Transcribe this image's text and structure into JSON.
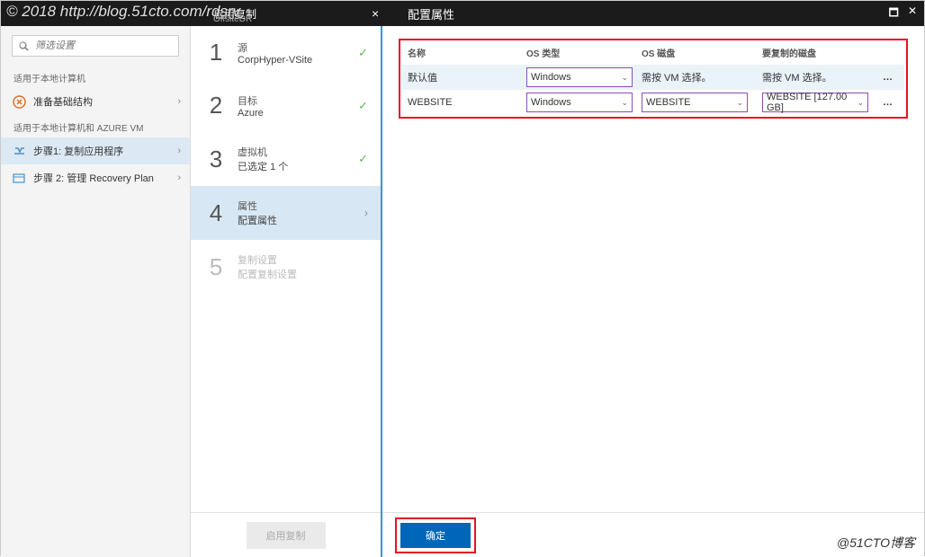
{
  "watermark": {
    "topleft": "© 2018 http://blog.51cto.com/rdsrv",
    "bottomright": "@51CTO博客"
  },
  "topbar": {
    "title1": "启用复制",
    "subtitle": "OffsiteDR",
    "title2": "配置属性"
  },
  "sidebar": {
    "search_placeholder": "筛选设置",
    "section1": "适用于本地计算机",
    "item_prepare": "准备基础结构",
    "section2": "适用于本地计算机和 AZURE VM",
    "item_step1": "步骤1: 复制应用程序",
    "item_step2": "步骤 2: 管理 Recovery Plan"
  },
  "wizard": {
    "steps": [
      {
        "num": "1",
        "label": "源",
        "sub": "CorpHyper-VSite"
      },
      {
        "num": "2",
        "label": "目标",
        "sub": "Azure"
      },
      {
        "num": "3",
        "label": "虚拟机",
        "sub": "已选定 1 个"
      },
      {
        "num": "4",
        "label": "属性",
        "sub": "配置属性"
      },
      {
        "num": "5",
        "label": "复制设置",
        "sub": "配置复制设置"
      }
    ],
    "footer_btn": "启用复制"
  },
  "detail": {
    "headers": {
      "name": "名称",
      "ostype": "OS 类型",
      "osdisk": "OS 磁盘",
      "repdisk": "要复制的磁盘"
    },
    "rows": [
      {
        "name": "默认值",
        "ostype": "Windows",
        "osdisk": "需按 VM 选择。",
        "repdisk": "需按 VM 选择。",
        "hl": true,
        "osdisk_sel": false,
        "repdisk_sel": false
      },
      {
        "name": "WEBSITE",
        "ostype": "Windows",
        "osdisk": "WEBSITE",
        "repdisk": "WEBSITE [127.00 GB]",
        "hl": false,
        "osdisk_sel": true,
        "repdisk_sel": true
      }
    ],
    "confirm_btn": "确定"
  }
}
